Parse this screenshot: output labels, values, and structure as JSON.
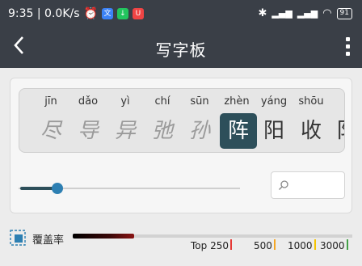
{
  "status_bar": {
    "time_and_speed": "9:35 | 0.0K/s",
    "battery": "91",
    "colors": {
      "alarm_icon": "#ffffff",
      "app1": "#3b82f6",
      "app2": "#22c55e",
      "app3": "#ef4444"
    }
  },
  "header": {
    "title": "写字板",
    "background": "#3a3f47"
  },
  "character_strip": {
    "items": [
      {
        "pinyin": "jīn",
        "hanzi": "尽",
        "style": "cursive"
      },
      {
        "pinyin": "dǎo",
        "hanzi": "导",
        "style": "cursive"
      },
      {
        "pinyin": "yì",
        "hanzi": "异",
        "style": "cursive"
      },
      {
        "pinyin": "chí",
        "hanzi": "弛",
        "style": "cursive"
      },
      {
        "pinyin": "sūn",
        "hanzi": "孙",
        "style": "cursive"
      },
      {
        "pinyin": "zhèn",
        "hanzi": "阵",
        "style": "active"
      },
      {
        "pinyin": "yáng",
        "hanzi": "阳",
        "style": "normal"
      },
      {
        "pinyin": "shōu",
        "hanzi": "收",
        "style": "normal"
      },
      {
        "pinyin": "",
        "hanzi": "阝",
        "style": "normal"
      }
    ],
    "active_color": "#2d4f5a"
  },
  "slider": {
    "value_percent": 10
  },
  "search": {
    "placeholder": "",
    "value": ""
  },
  "coverage": {
    "label": "覆盖率",
    "fill_fraction": 0.22,
    "marks": [
      {
        "text": "Top 250",
        "color": "#e53935"
      },
      {
        "text": "500",
        "color": "#f5a623"
      },
      {
        "text": "1000",
        "color": "#f5c400"
      },
      {
        "text": "3000",
        "color": "#43a047"
      }
    ]
  }
}
